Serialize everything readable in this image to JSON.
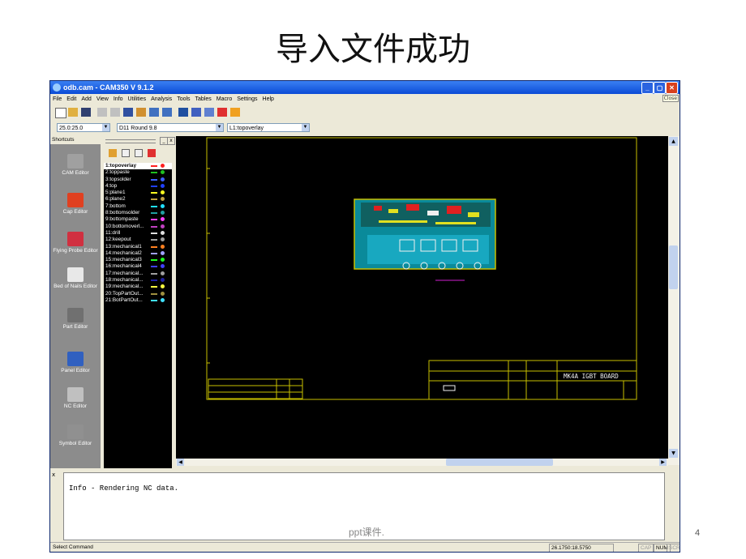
{
  "slide": {
    "title": "导入文件成功",
    "footer": "ppt课件.",
    "page_number": "4"
  },
  "window": {
    "title": "odb.cam - CAM350 V 9.1.2",
    "close_tooltip": "Close"
  },
  "menu": [
    "File",
    "Edit",
    "Add",
    "View",
    "Info",
    "Utilities",
    "Analysis",
    "Tools",
    "Tables",
    "Macro",
    "Settings",
    "Help"
  ],
  "combos": {
    "grid": "25.0:25.0",
    "dcode": "D11  Round 9.8",
    "layer": "L1:topoverlay"
  },
  "shortcuts": {
    "header": "Shortcuts",
    "items": [
      {
        "label": "CAM Editor",
        "color": "#a0a0a0"
      },
      {
        "label": "Cap Editor",
        "color": "#e04020"
      },
      {
        "label": "Flying Probe Editor",
        "color": "#d03040"
      },
      {
        "label": "Bed of Nails Editor",
        "color": "#e8e8e8"
      },
      {
        "label": "Part Editor",
        "color": "#707070"
      },
      {
        "label": "Panel Editor",
        "color": "#3060c0"
      },
      {
        "label": "NC Editor",
        "color": "#c0c0c0"
      },
      {
        "label": "Symbol Editor",
        "color": "#909090"
      }
    ]
  },
  "layers": [
    {
      "name": "1:topoverlay",
      "color": "#ff2020",
      "selected": true
    },
    {
      "name": "2:toppaste",
      "color": "#20c020"
    },
    {
      "name": "3:topsolder",
      "color": "#4060ff"
    },
    {
      "name": "4:top",
      "color": "#2040ff"
    },
    {
      "name": "5:plane1",
      "color": "#ffff20"
    },
    {
      "name": "6:plane2",
      "color": "#c0a040"
    },
    {
      "name": "7:bottom",
      "color": "#20e0ff"
    },
    {
      "name": "8:bottomsolder",
      "color": "#20a0a0"
    },
    {
      "name": "9:bottompaste",
      "color": "#ff40ff"
    },
    {
      "name": "10:bottomoverl...",
      "color": "#c040c0"
    },
    {
      "name": "11:drill",
      "color": "#e0e0e0"
    },
    {
      "name": "12:keepout",
      "color": "#a0a0a0"
    },
    {
      "name": "13:mechanical1",
      "color": "#ff8020"
    },
    {
      "name": "14:mechanical2",
      "color": "#a0a0ff"
    },
    {
      "name": "15:mechanical3",
      "color": "#20ff20"
    },
    {
      "name": "16:mechanical4",
      "color": "#4040ff"
    },
    {
      "name": "17:mechanical...",
      "color": "#a0a0a0"
    },
    {
      "name": "18:mechanical...",
      "color": "#2020a0"
    },
    {
      "name": "19:mechanical...",
      "color": "#ffff40"
    },
    {
      "name": "20:TopPartOut...",
      "color": "#a09040"
    },
    {
      "name": "21:BotPartOut...",
      "color": "#40e0ff"
    }
  ],
  "board": {
    "title_block_text": "MK4A IGBT BOARD"
  },
  "output": {
    "message": "Info - Rendering NC data."
  },
  "status": {
    "left": "Select Command",
    "coords": "26.1750:18.5750",
    "caps": "CAP",
    "num": "NUM",
    "scrl": "SCRL"
  }
}
